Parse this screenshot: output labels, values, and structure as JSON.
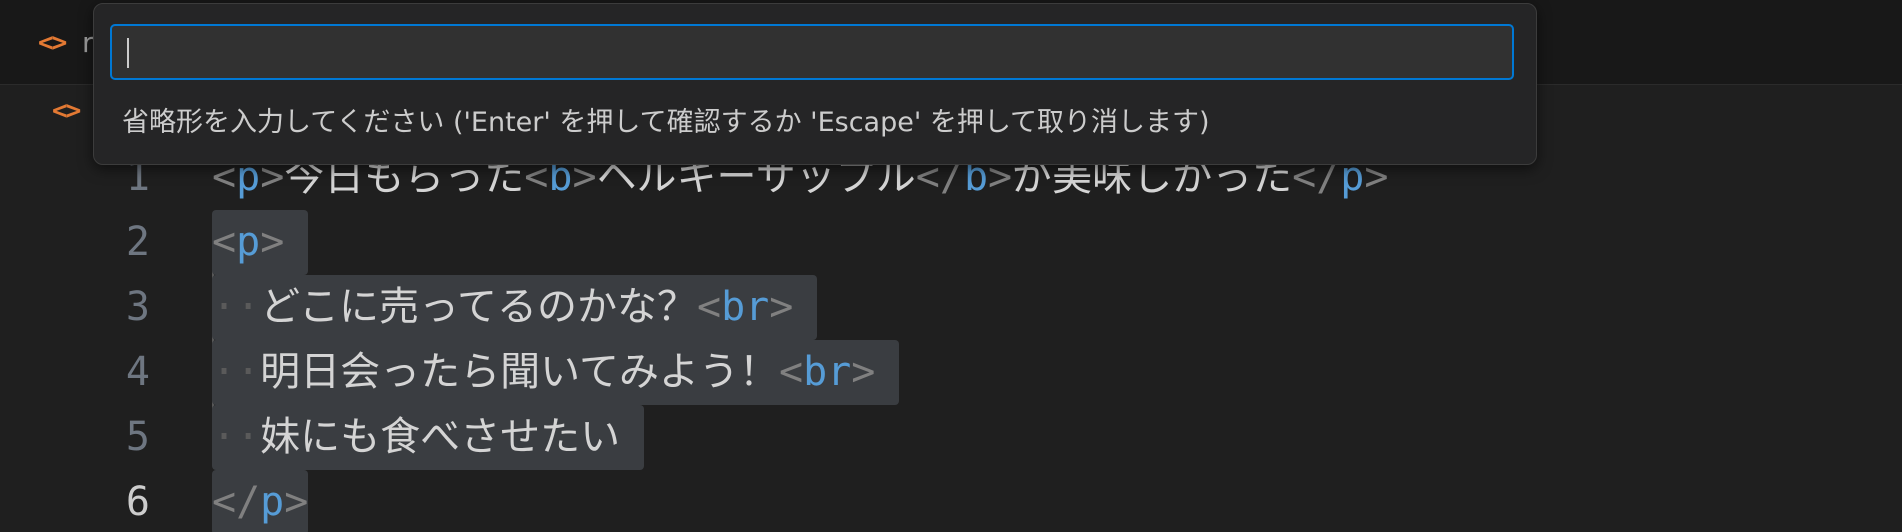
{
  "tab": {
    "icon": "html-file-icon",
    "label_fragment": "r"
  },
  "breadcrumb": {
    "icon": "html-file-icon"
  },
  "quick_input": {
    "value": "",
    "hint": "省略形を入力してください ('Enter' を押して確認するか 'Escape' を押して取り消します)"
  },
  "editor": {
    "active_line": 6,
    "lines": [
      {
        "number": "1",
        "text": "<p>今日もらった<b>ヘルキーサップル</b>が美味しかった</p>"
      },
      {
        "number": "2",
        "text": "<p>"
      },
      {
        "number": "3",
        "text": "  どこに売ってるのかな？<br>"
      },
      {
        "number": "4",
        "text": "  明日会ったら聞いてみよう！<br>"
      },
      {
        "number": "5",
        "text": "  妹にも食べさせたい"
      },
      {
        "number": "6",
        "text": "</p>"
      }
    ],
    "tokens": {
      "l1_open_lt": "<",
      "l1_p": "p",
      "l1_open_gt": ">",
      "l1_t1": "今日もらった",
      "l1_b_lt": "<",
      "l1_b": "b",
      "l1_b_gt": ">",
      "l1_t2": "ヘルキーサップル",
      "l1_bc_lt": "</",
      "l1_bc": "b",
      "l1_bc_gt": ">",
      "l1_t3": "が美味しかった",
      "l1_pc_lt": "</",
      "l1_pc": "p",
      "l1_pc_gt": ">",
      "l2_lt": "<",
      "l2_p": "p",
      "l2_gt": ">",
      "l3_ws": "··",
      "l3_t": "どこに売ってるのかな？",
      "l3_lt": "<",
      "l3_br": "br",
      "l3_gt": ">",
      "l4_ws": "··",
      "l4_t": "明日会ったら聞いてみよう！",
      "l4_lt": "<",
      "l4_br": "br",
      "l4_gt": ">",
      "l5_ws": "··",
      "l5_t": "妹にも食べさせたい",
      "l6_lt": "</",
      "l6_p": "p",
      "l6_gt": ">"
    }
  },
  "colors": {
    "accent_focus": "#0078d4",
    "tag": "#569cd6",
    "punctuation": "#808080",
    "text": "#d4d4d4",
    "selection": "#3a3d41",
    "html_icon": "#e37933"
  }
}
